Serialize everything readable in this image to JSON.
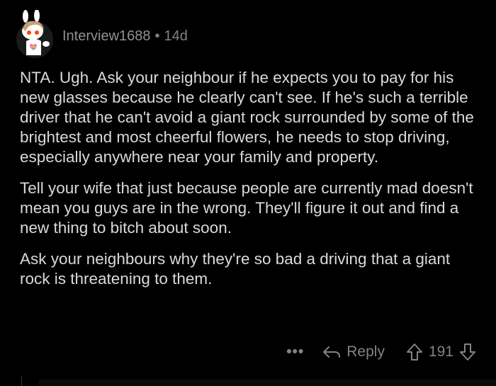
{
  "comment": {
    "author": "Interview1688",
    "separator": "•",
    "age": "14d",
    "paragraphs": [
      "NTA. Ugh. Ask your neighbour if he expects you to pay for his new glasses because he clearly can't see. If he's such a terrible driver that he can't avoid a giant rock surrounded by some of the brightest and most cheerful flowers, he needs to stop driving, especially anywhere near your family and property.",
      "Tell your wife that just because people are currently mad doesn't mean you guys are in the wrong. They'll figure it out and find a new thing to bitch about soon.",
      "Ask your neighbours why they're so bad a driving that a giant rock is threatening to them."
    ]
  },
  "actions": {
    "more_label": "•••",
    "reply_label": "Reply",
    "vote_count": "191"
  },
  "icons": {
    "avatar": "snoo-avatar-icon",
    "more": "more-options-icon",
    "reply": "reply-arrow-icon",
    "upvote": "upvote-arrow-icon",
    "downvote": "downvote-arrow-icon"
  },
  "colors": {
    "background": "#000000",
    "text": "#d7dadc",
    "meta": "#818384"
  }
}
